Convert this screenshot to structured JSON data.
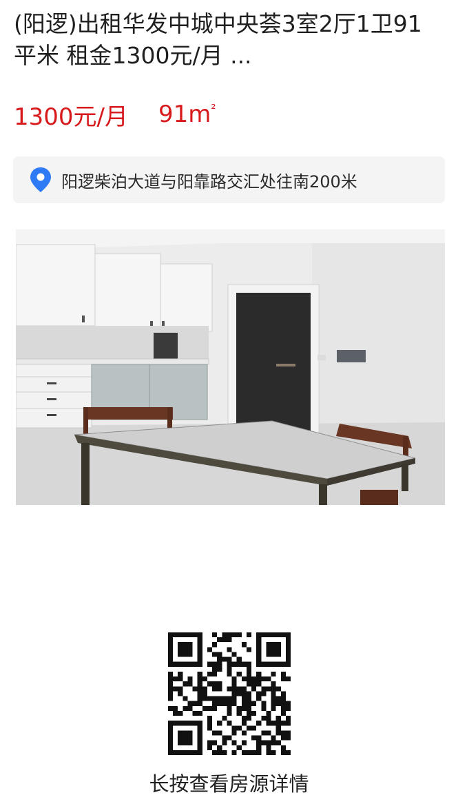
{
  "listing": {
    "title": "(阳逻)出租华发中城中央荟3室2厅1卫91平米 租金1300元/月 ...",
    "price": "1300元/月",
    "area_value": "91m",
    "area_sup": "²"
  },
  "location": {
    "icon": "location-pin-icon",
    "address": "阳逻柴泊大道与阳靠路交汇处往南200米"
  },
  "photo": {
    "subject": "room-photo"
  },
  "qr": {
    "icon": "qr-code",
    "caption": "长按查看房源详情"
  },
  "colors": {
    "price": "#d8191c",
    "pin": "#2f7bf5",
    "card_bg": "#f4f4f5"
  }
}
